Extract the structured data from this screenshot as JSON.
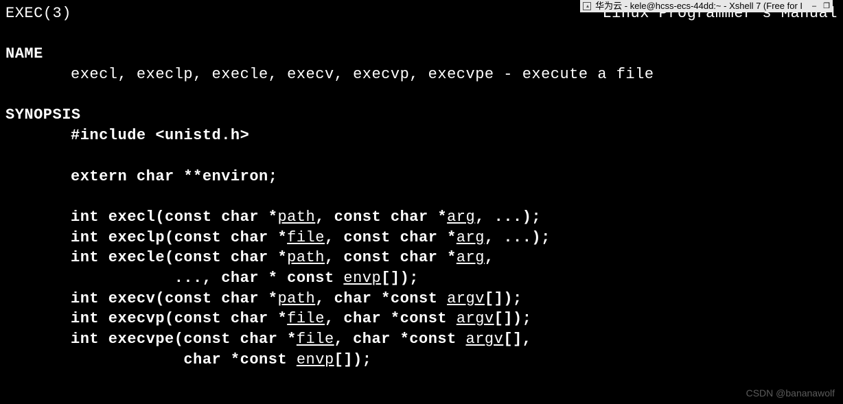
{
  "titlebar": {
    "text": "华为云 - kele@hcss-ecs-44dd:~ - Xshell 7 (Free for I",
    "minimize": "–",
    "maximize": "❐"
  },
  "header": {
    "left": "EXEC(3)",
    "right": "Linux Programmer's Manual"
  },
  "sections": {
    "name_heading": "NAME",
    "name_body": "execl, execlp, execle, execv, execvp, execvpe - execute a file",
    "synopsis_heading": "SYNOPSIS",
    "include": "#include <unistd.h>",
    "extern": "extern char **environ;",
    "sig1_pre": "int execl(const char *",
    "sig1_u1": "path",
    "sig1_mid": ", const char *",
    "sig1_u2": "arg",
    "sig1_post": ", ...);",
    "sig2_pre": "int execlp(const char *",
    "sig2_u1": "file",
    "sig2_mid": ", const char *",
    "sig2_u2": "arg",
    "sig2_post": ", ...);",
    "sig3_pre": "int execle(const char *",
    "sig3_u1": "path",
    "sig3_mid": ", const char *",
    "sig3_u2": "arg",
    "sig3_post": ",",
    "sig3b_pre": "           ..., char * const ",
    "sig3b_u": "envp",
    "sig3b_post": "[]);",
    "sig4_pre": "int execv(const char *",
    "sig4_u1": "path",
    "sig4_mid": ", char *const ",
    "sig4_u2": "argv",
    "sig4_post": "[]);",
    "sig5_pre": "int execvp(const char *",
    "sig5_u1": "file",
    "sig5_mid": ", char *const ",
    "sig5_u2": "argv",
    "sig5_post": "[]);",
    "sig6_pre": "int execvpe(const char *",
    "sig6_u1": "file",
    "sig6_mid": ", char *const ",
    "sig6_u2": "argv",
    "sig6_post": "[],",
    "sig6b_pre": "            char *const ",
    "sig6b_u": "envp",
    "sig6b_post": "[]);"
  },
  "watermark": "CSDN @bananawolf"
}
